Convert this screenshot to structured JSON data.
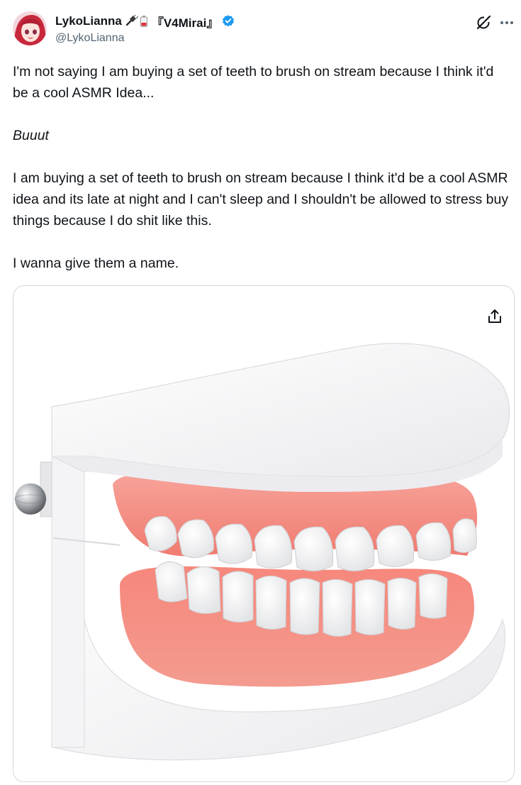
{
  "author": {
    "display_name": "LykoLianna",
    "name_suffix": "『V4Mirai』",
    "handle": "@LykoLianna",
    "emoji_icons": [
      "plug-icon",
      "battery-icon"
    ],
    "verified": true
  },
  "tweet": {
    "paragraphs": [
      "I'm not saying I am buying a set of teeth to brush on stream because I think it'd be a cool ASMR Idea...",
      "Buuut",
      "I am buying a set of teeth to brush on stream because I think it'd be a cool ASMR idea and its late at night and I can't sleep and I shouldn't be allowed to stress buy things because I do shit like this.",
      "I wanna give them a name."
    ]
  },
  "media": {
    "subject": "dental-model-icon"
  },
  "colors": {
    "text": "#0f1419",
    "secondary_text": "#536471",
    "verified_blue": "#1d9bf0",
    "border": "#cfd9de",
    "gum_pink": "#f4857d"
  }
}
